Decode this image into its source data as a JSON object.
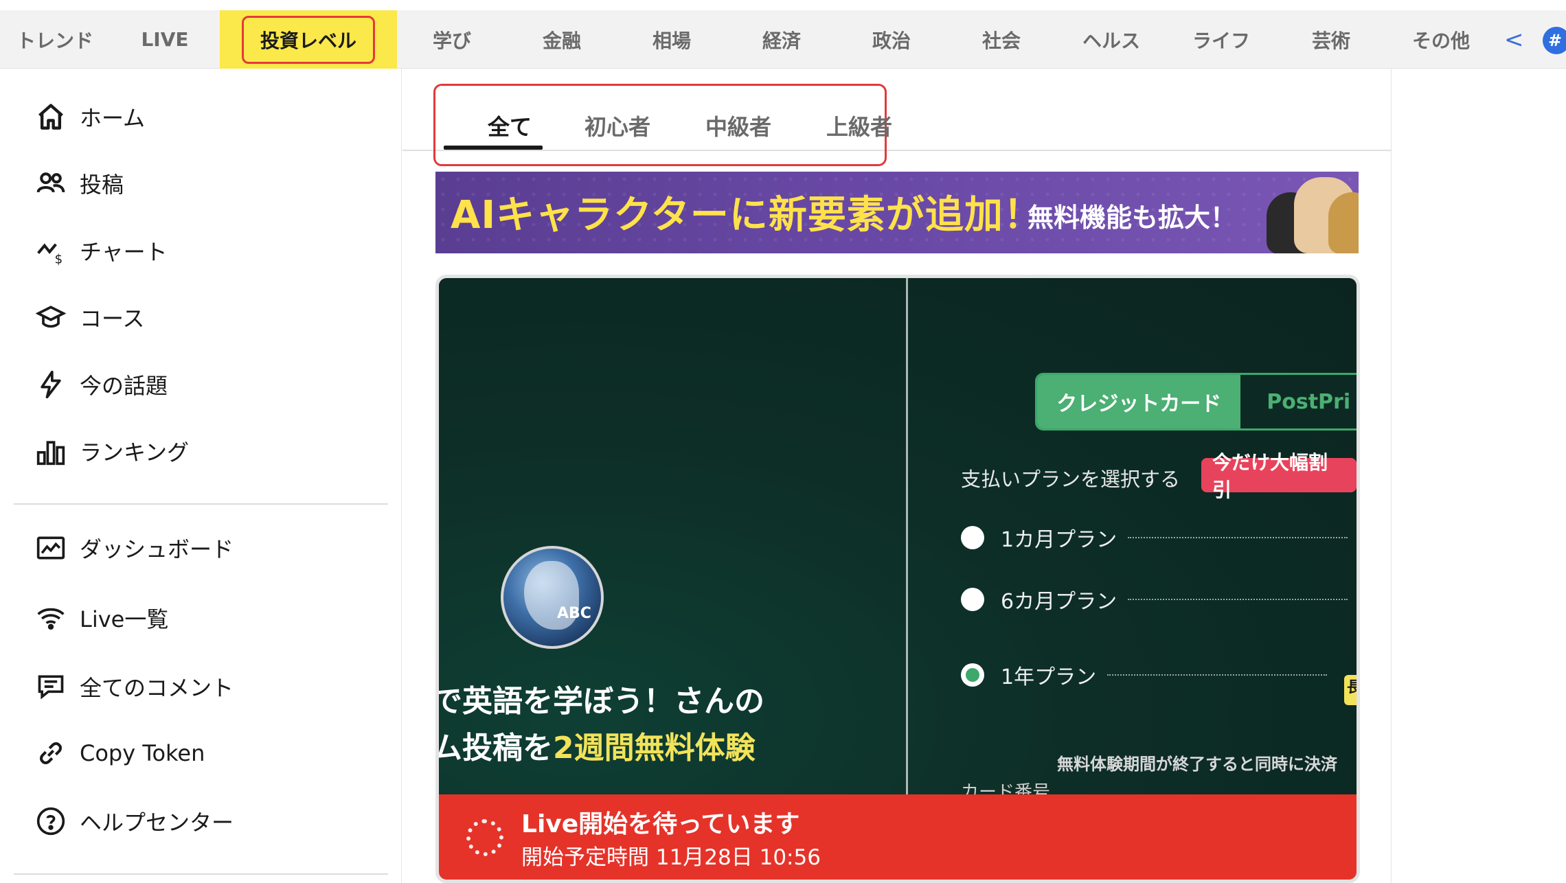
{
  "categories": [
    {
      "label": "トレンド",
      "active": false
    },
    {
      "label": "LIVE",
      "active": false
    },
    {
      "label": "投資レベル",
      "active": true
    },
    {
      "label": "学び",
      "active": false
    },
    {
      "label": "金融",
      "active": false
    },
    {
      "label": "相場",
      "active": false
    },
    {
      "label": "経済",
      "active": false
    },
    {
      "label": "政治",
      "active": false
    },
    {
      "label": "社会",
      "active": false
    },
    {
      "label": "ヘルス",
      "active": false
    },
    {
      "label": "ライフ",
      "active": false
    },
    {
      "label": "芸術",
      "active": false
    },
    {
      "label": "その他",
      "active": false
    }
  ],
  "topbar": {
    "scroll_left_glyph": "<",
    "hash_glyph": "#"
  },
  "sidebar": {
    "items": [
      {
        "label": "ホーム",
        "icon": "home-icon"
      },
      {
        "label": "投稿",
        "icon": "users-icon"
      },
      {
        "label": "チャート",
        "icon": "chart-dollar-icon"
      },
      {
        "label": "コース",
        "icon": "graduation-cap-icon"
      },
      {
        "label": "今の話題",
        "icon": "lightning-icon"
      },
      {
        "label": "ランキング",
        "icon": "ranking-bars-icon"
      }
    ],
    "items2": [
      {
        "label": "ダッシュボード",
        "icon": "dashboard-icon"
      },
      {
        "label": "Live一覧",
        "icon": "wifi-icon"
      },
      {
        "label": "全てのコメント",
        "icon": "comment-icon"
      },
      {
        "label": "Copy Token",
        "icon": "link-icon"
      },
      {
        "label": "ヘルプセンター",
        "icon": "help-icon"
      }
    ]
  },
  "level_tabs": [
    {
      "label": "全て",
      "active": true
    },
    {
      "label": "初心者",
      "active": false
    },
    {
      "label": "中級者",
      "active": false
    },
    {
      "label": "上級者",
      "active": false
    }
  ],
  "banner": {
    "headline": "AIキャラクターに新要素が追加！",
    "sub": "無料機能も拡大！"
  },
  "card": {
    "thumb_line1": "で英語を学ぼう！さんの",
    "thumb_line2_prefix": "ム投稿を",
    "thumb_line2_highlight": "2週間無料体験",
    "logo_text": "ABC",
    "pay_tab_on": "クレジットカード",
    "pay_tab_off": "PostPri",
    "plan_heading": "支払いプランを選択する",
    "plan_badge": "今だけ大幅割引",
    "plans": [
      {
        "label": "1カ月プラン",
        "selected": false
      },
      {
        "label": "6カ月プラン",
        "selected": false
      },
      {
        "label": "1年プラン",
        "selected": true
      }
    ],
    "plan_yellow_mark": "長",
    "note": "無料体験期間が終了すると同時に決済",
    "card_number_label": "カード番号",
    "live_title": "Live開始を待っています",
    "live_time": "開始予定時間 11月28日 10:56"
  },
  "colors": {
    "accent_yellow": "#fbe84a",
    "highlight_red": "#e23a3a",
    "live_red": "#e5332a",
    "pay_green": "#4caf73",
    "banner_purple": "#5a3e92"
  }
}
